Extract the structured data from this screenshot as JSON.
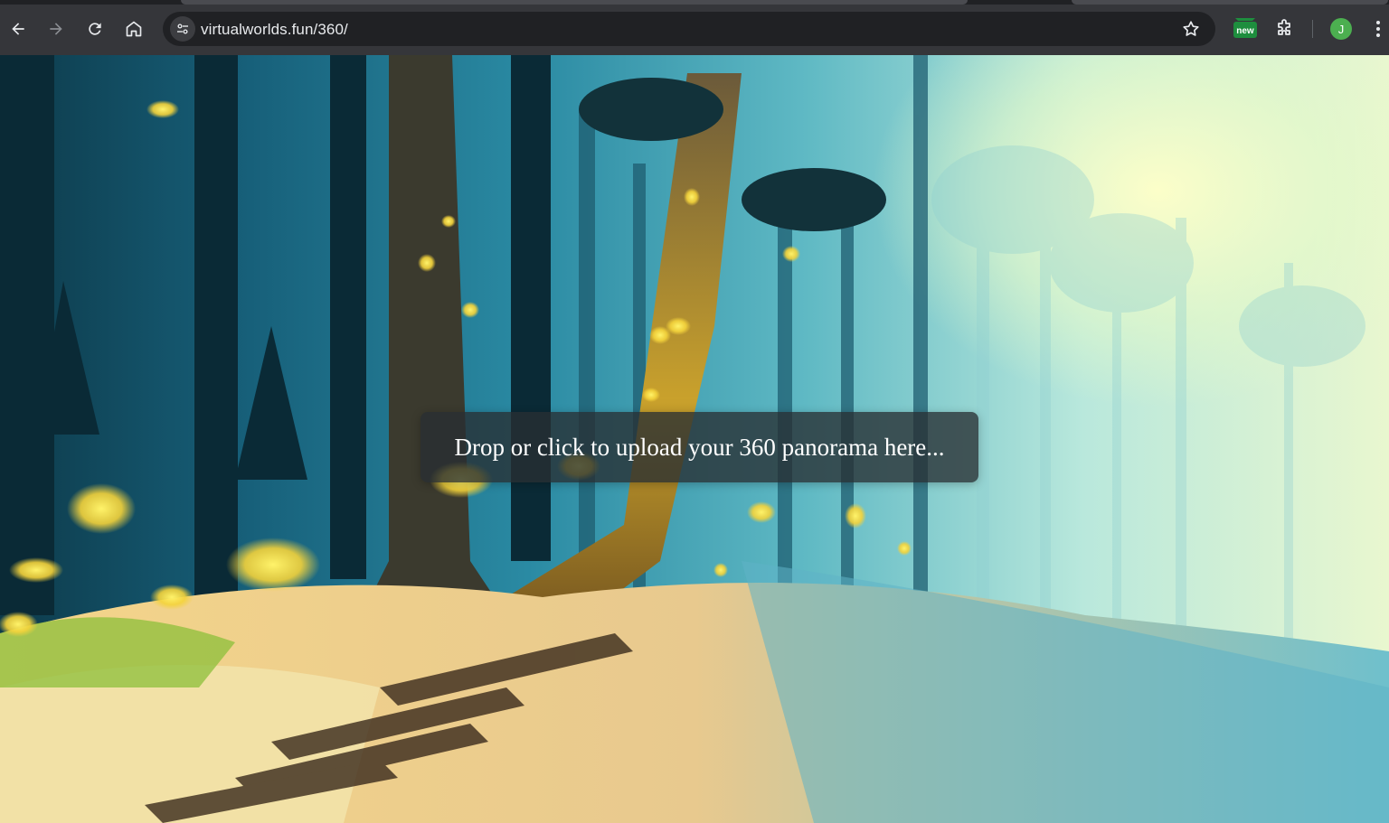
{
  "browser": {
    "url": "virtualworlds.fun/360/",
    "extension_badge": "new",
    "profile_initial": "J"
  },
  "page": {
    "upload_prompt": "Drop or click to upload your 360 panorama here..."
  },
  "icons": {
    "back": "back-arrow-icon",
    "forward": "forward-arrow-icon",
    "reload": "reload-icon",
    "home": "home-icon",
    "site_info": "tune-icon",
    "bookmark": "star-icon",
    "extensions": "puzzle-icon",
    "menu": "kebab-menu-icon"
  },
  "colors": {
    "chrome_bg": "#35363a",
    "omnibox_bg": "#202124",
    "avatar_bg": "#4caf50",
    "badge_bg": "#1e8e3e"
  }
}
